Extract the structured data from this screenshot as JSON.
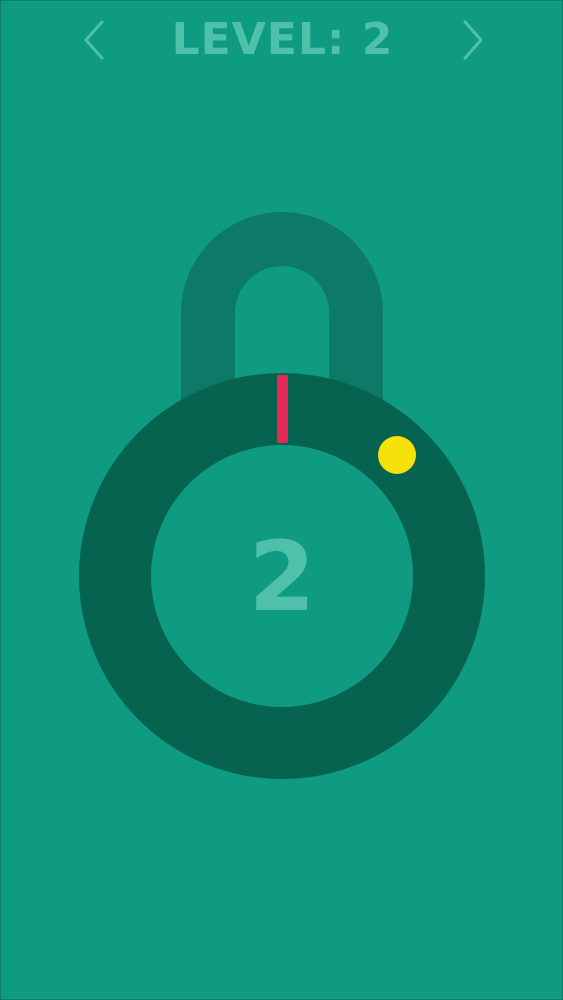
{
  "header": {
    "title": "LEVEL: 2",
    "prev_icon": "chevron-left-icon",
    "next_icon": "chevron-right-icon"
  },
  "lock": {
    "level_number": "2",
    "colors": {
      "background": "#0f9a82",
      "shackle": "#0c7a66",
      "ring": "#05634f",
      "inner": "#0f9a82",
      "needle": "#e5275a",
      "target_dot": "#f7e10a",
      "text": "#4fc0aa"
    }
  }
}
